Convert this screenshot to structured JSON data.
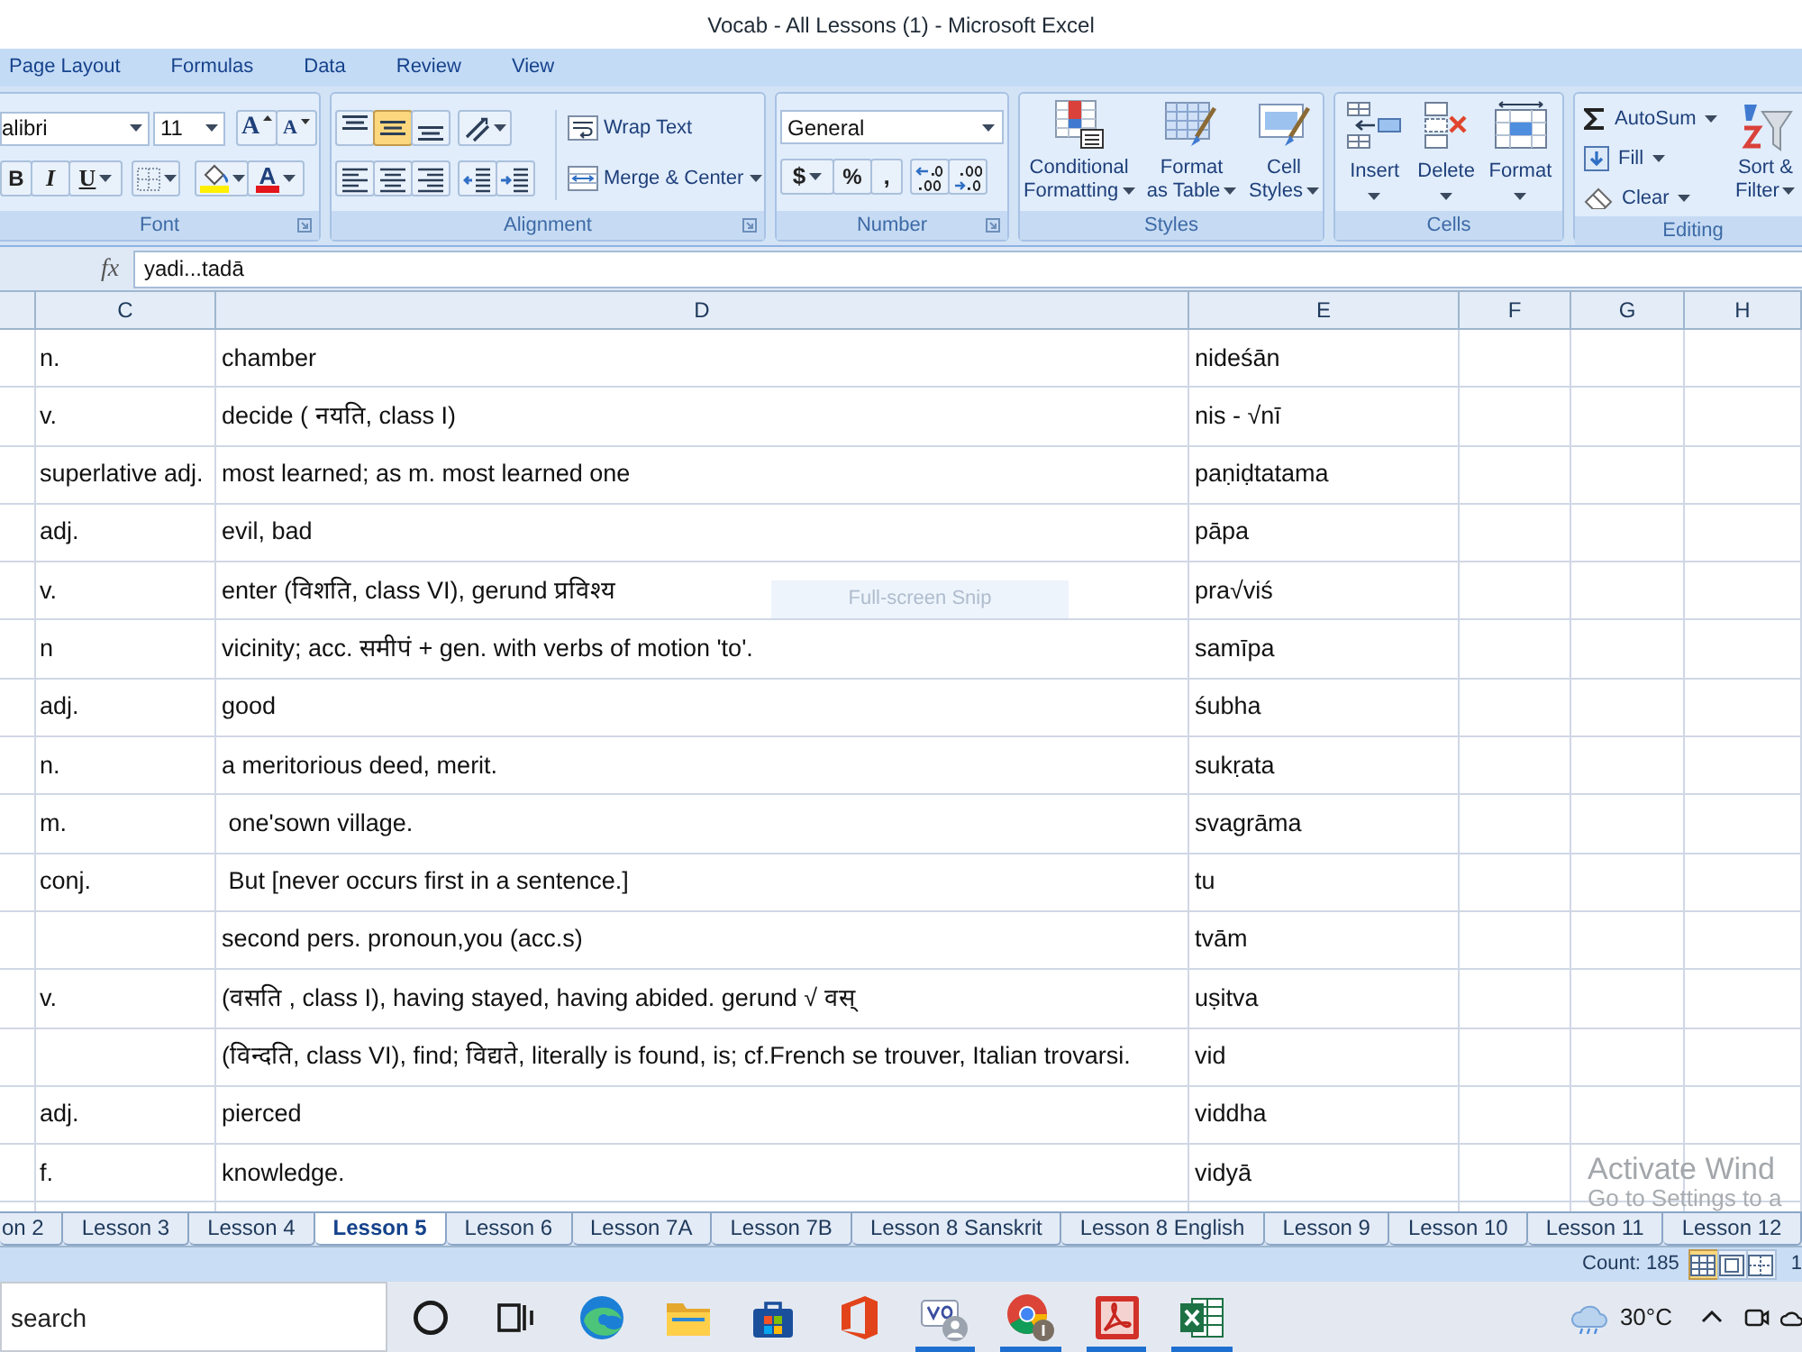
{
  "window": {
    "title": "Vocab - All Lessons (1) - Microsoft Excel"
  },
  "ribbon": {
    "tabs": [
      "Page Layout",
      "Formulas",
      "Data",
      "Review",
      "View"
    ],
    "font": {
      "label": "Font",
      "font_name": "alibri",
      "font_size": "11",
      "grow": "A",
      "shrink": "A",
      "bold": "B",
      "italic": "I",
      "underline": "U",
      "font_color": "A"
    },
    "alignment": {
      "label": "Alignment",
      "vertical_align": [
        {
          "selected": false
        },
        {
          "selected": true
        },
        {
          "selected": false
        }
      ],
      "wrap_text": "Wrap Text",
      "merge": "Merge & Center"
    },
    "number": {
      "label": "Number",
      "format": "General",
      "currency": "$",
      "percent": "%",
      "comma": ","
    },
    "styles": {
      "label": "Styles",
      "buttons": [
        "Conditional\nFormatting",
        "Format\nas Table",
        "Cell\nStyles"
      ]
    },
    "cells": {
      "label": "Cells",
      "buttons": [
        "Insert",
        "Delete",
        "Format"
      ]
    },
    "editing": {
      "label": "Editing",
      "items": [
        "AutoSum",
        "Fill",
        "Clear"
      ],
      "sort": "Sort &\nFilter"
    }
  },
  "formula_bar": {
    "function_label": "fx",
    "value": "yadi...tadā"
  },
  "sheet": {
    "columns": [
      "C",
      "D",
      "E",
      "F",
      "G",
      "H"
    ],
    "rows": [
      {
        "C": "n.",
        "D": "chamber",
        "E": "nideśān"
      },
      {
        "C": "v.",
        "D": "decide ( नयति, class I)",
        "E": "nis - √nī"
      },
      {
        "C": "superlative adj.",
        "D": "most learned; as m. most learned one",
        "E": "paṇiḍtatama"
      },
      {
        "C": "adj.",
        "D": "evil, bad",
        "E": "pāpa"
      },
      {
        "C": "v.",
        "D": "enter (विशति, class VI), gerund प्रविश्य",
        "E": "pra√viś"
      },
      {
        "C": "n",
        "D": "vicinity; acc. समीपं + gen. with verbs of motion 'to'.",
        "E": "samīpa"
      },
      {
        "C": "adj.",
        "D": "good",
        "E": "śubha"
      },
      {
        "C": "n.",
        "D": "a meritorious deed, merit.",
        "E": "sukṛata"
      },
      {
        "C": "m.",
        "D": " one'sown village.",
        "E": "svagrāma"
      },
      {
        "C": "conj.",
        "D": " But [never occurs first in a sentence.]",
        "E": "tu"
      },
      {
        "D": "second pers. pronoun,you (acc.s)",
        "E": "tvām"
      },
      {
        "C": "v.",
        "D": "(वसति , class I), having stayed, having abided. gerund √ वस्",
        "E": "uṣitva"
      },
      {
        "D": "(विन्दति, class VI), find; विद्यते, literally is found, is; cf.French se trouver, Italian trovarsi.",
        "E": "vid"
      },
      {
        "C": "adj.",
        "D": "pierced",
        "E": "viddha"
      },
      {
        "C": "f.",
        "D": "knowledge.",
        "E": "vidyā"
      }
    ]
  },
  "tooltip": "Full-screen Snip",
  "activation_notice": {
    "title": "Activate Wind",
    "subtitle": "Go to Settings to a"
  },
  "sheet_tabs": [
    {
      "label": "on 2",
      "selected": false
    },
    {
      "label": "Lesson 3",
      "selected": false
    },
    {
      "label": "Lesson 4",
      "selected": false
    },
    {
      "label": "Lesson 5",
      "selected": true
    },
    {
      "label": "Lesson 6",
      "selected": false
    },
    {
      "label": "Lesson 7A",
      "selected": false
    },
    {
      "label": "Lesson 7B",
      "selected": false
    },
    {
      "label": "Lesson 8 Sanskrit",
      "selected": false
    },
    {
      "label": "Lesson 8 English",
      "selected": false
    },
    {
      "label": "Lesson 9",
      "selected": false
    },
    {
      "label": "Lesson 10",
      "selected": false
    },
    {
      "label": "Lesson 11",
      "selected": false
    },
    {
      "label": "Lesson 12",
      "selected": false
    }
  ],
  "status_bar": {
    "count": "Count: 185",
    "view_buttons": [
      {
        "selected": true
      },
      {
        "selected": false
      },
      {
        "selected": false
      }
    ],
    "zoom": "1"
  },
  "taskbar": {
    "search_box": {
      "placeholder": "search"
    },
    "apps": [
      {
        "kind": "circle",
        "open": false
      },
      {
        "kind": "taskview",
        "open": false
      },
      {
        "kind": "edge",
        "open": false
      },
      {
        "kind": "folder",
        "open": false
      },
      {
        "kind": "store",
        "open": false
      },
      {
        "kind": "office",
        "open": false
      },
      {
        "kind": "meeting",
        "open": true
      },
      {
        "kind": "chrome",
        "open": true
      },
      {
        "kind": "reader",
        "open": true
      },
      {
        "kind": "excel",
        "open": true
      }
    ],
    "temperature": "30°C"
  }
}
